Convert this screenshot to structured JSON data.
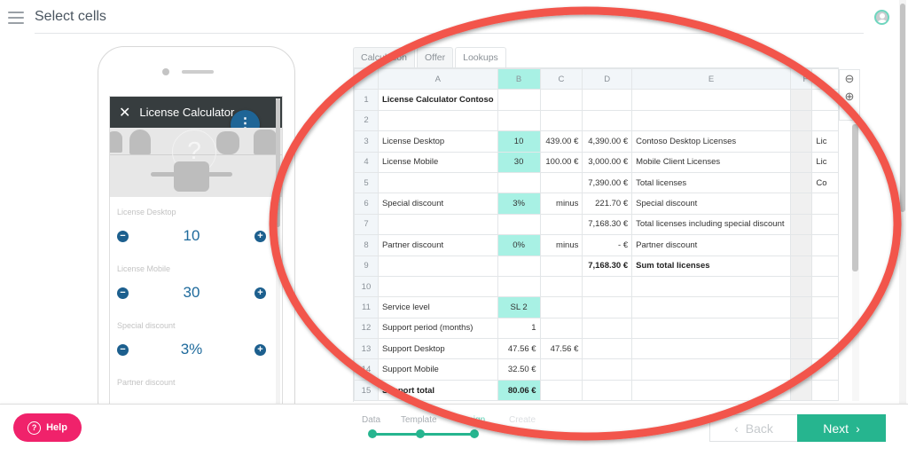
{
  "header": {
    "title": "Select cells",
    "menu_icon": "hamburger-icon",
    "avatar_icon": "user-avatar-icon"
  },
  "phone": {
    "app_title": "License Calculator",
    "close_icon": "✕",
    "fab_icon": "⋮",
    "steppers": [
      {
        "label": "License Desktop",
        "value": "10"
      },
      {
        "label": "License Mobile",
        "value": "30"
      },
      {
        "label": "Special discount",
        "value": "3%"
      },
      {
        "label": "Partner discount",
        "value": ""
      }
    ],
    "minus_glyph": "−",
    "plus_glyph": "+"
  },
  "sheet": {
    "tabs": [
      {
        "label": "Calculation",
        "active": false
      },
      {
        "label": "Offer",
        "active": false
      },
      {
        "label": "Lookups",
        "active": true
      }
    ],
    "columns": [
      "A",
      "B",
      "C",
      "D",
      "E",
      "F",
      ""
    ],
    "selected_column": "B",
    "rows": [
      {
        "n": "1",
        "cells": [
          "License Calculator Contoso",
          "",
          "",
          "",
          "",
          "",
          ""
        ]
      },
      {
        "n": "2",
        "cells": [
          "",
          "",
          "",
          "",
          "",
          "",
          ""
        ]
      },
      {
        "n": "3",
        "cells": [
          "License Desktop",
          "10",
          "439.00 €",
          "4,390.00 €",
          "Contoso Desktop Licenses",
          "",
          "Lic"
        ]
      },
      {
        "n": "4",
        "cells": [
          "License Mobile",
          "30",
          "100.00 €",
          "3,000.00 €",
          "Mobile Client Licenses",
          "",
          "Lic"
        ]
      },
      {
        "n": "5",
        "cells": [
          "",
          "",
          "",
          "7,390.00 €",
          "Total licenses",
          "",
          "Co"
        ]
      },
      {
        "n": "6",
        "cells": [
          "Special discount",
          "3%",
          "minus",
          "221.70 €",
          "Special discount",
          "",
          ""
        ]
      },
      {
        "n": "7",
        "cells": [
          "",
          "",
          "",
          "7,168.30 €",
          "Total licenses including special discount",
          "",
          ""
        ]
      },
      {
        "n": "8",
        "cells": [
          "Partner discount",
          "0%",
          "minus",
          "- €",
          "Partner discount",
          "",
          ""
        ]
      },
      {
        "n": "9",
        "cells": [
          "",
          "",
          "",
          "7,168.30 €",
          "Sum total licenses",
          "",
          ""
        ]
      },
      {
        "n": "10",
        "cells": [
          "",
          "",
          "",
          "",
          "",
          "",
          ""
        ]
      },
      {
        "n": "11",
        "cells": [
          "Service level",
          "SL 2",
          "",
          "",
          "",
          "",
          ""
        ]
      },
      {
        "n": "12",
        "cells": [
          "Support period (months)",
          "1",
          "",
          "",
          "",
          "",
          ""
        ]
      },
      {
        "n": "13",
        "cells": [
          "Support Desktop",
          "47.56 €",
          "47.56 €",
          "",
          "",
          "",
          ""
        ]
      },
      {
        "n": "14",
        "cells": [
          "Support Mobile",
          "32.50 €",
          "",
          "",
          "",
          "",
          ""
        ]
      },
      {
        "n": "15",
        "cells": [
          "Support total",
          "80.06 €",
          "",
          "",
          "",
          "",
          ""
        ]
      }
    ],
    "zoom_out_icon": "⊖",
    "zoom_in_icon": "⊕"
  },
  "footer": {
    "help_label": "Help",
    "help_icon": "?",
    "steps": [
      {
        "label": "Data",
        "state": "done"
      },
      {
        "label": "Template",
        "state": "done"
      },
      {
        "label": "Design",
        "state": "active"
      },
      {
        "label": "Create",
        "state": "future"
      }
    ],
    "back_label": "Back",
    "back_icon": "‹",
    "next_label": "Next",
    "next_icon": "›"
  },
  "colors": {
    "accent_green": "#26b58f",
    "selection_teal": "#a8f1e4",
    "help_pink": "#f0226b",
    "annotation_red": "#f2544c",
    "app_bar": "#373d3f",
    "stepper_blue": "#1c5f8e"
  }
}
